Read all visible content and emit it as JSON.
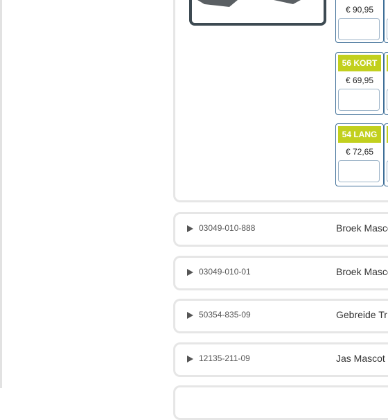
{
  "sizes": [
    {
      "label": "",
      "price": "€ 90,95"
    },
    {
      "label": "56 KORT",
      "price": "€ 69,95"
    },
    {
      "label": "54 LANG",
      "price": "€ 72,65"
    }
  ],
  "products": [
    {
      "code": "03049-010-888",
      "description": "Broek Masco"
    },
    {
      "code": "03049-010-01",
      "description": "Broek Masco"
    },
    {
      "code": "50354-835-09",
      "description": "Gebreide Tr"
    },
    {
      "code": "12135-211-09",
      "description": "Jas Mascot"
    }
  ],
  "colors": {
    "badge": "#c2d01e",
    "card_border": "#3f6f98"
  },
  "icons": {
    "expand": "triangle-right-icon"
  }
}
